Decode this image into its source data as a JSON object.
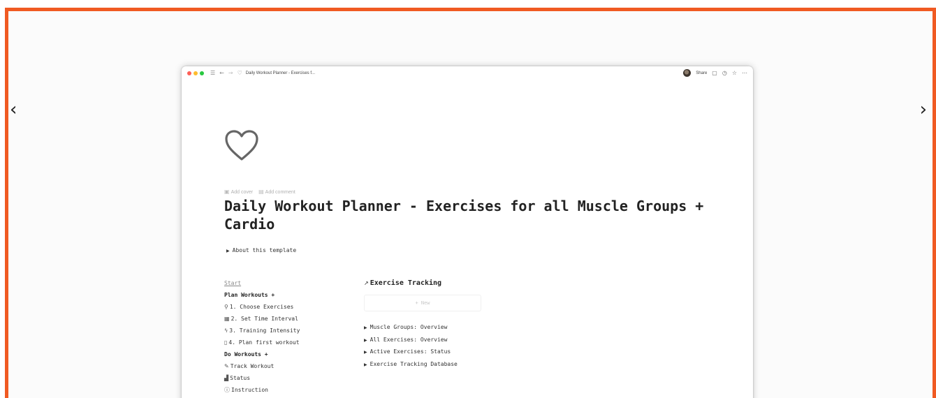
{
  "carousel": {
    "prev_glyph": "‹",
    "next_glyph": "›"
  },
  "browser": {
    "title": "Daily Workout Planner - Exercises f...",
    "share_label": "Share",
    "icons": [
      "sidebar-icon",
      "back-arrow-icon",
      "forward-arrow-icon",
      "heart-icon",
      "comment-icon",
      "history-icon",
      "star-icon",
      "more-icon"
    ]
  },
  "page": {
    "icon": "heart-outline",
    "add_cover": "Add cover",
    "add_comment": "Add comment",
    "title": "Daily Workout Planner - Exercises for all Muscle Groups + Cardio",
    "about_toggle": "About this template"
  },
  "left_nav": {
    "start": "Start",
    "plan_heading": "Plan Workouts +",
    "plan_items": [
      {
        "icon": "magnifier-icon",
        "label": "1. Choose Exercises"
      },
      {
        "icon": "calendar-icon",
        "label": "2. Set Time Interval"
      },
      {
        "icon": "lightning-icon",
        "label": "3. Training Intensity"
      },
      {
        "icon": "document-icon",
        "label": "4. Plan first workout"
      }
    ],
    "do_heading": "Do Workouts +",
    "do_items": [
      {
        "icon": "pencil-icon",
        "label": "Track Workout"
      },
      {
        "icon": "chart-icon",
        "label": "Status"
      },
      {
        "icon": "info-icon",
        "label": "Instruction"
      }
    ]
  },
  "right_section": {
    "linked_db_title": "Exercise Tracking",
    "new_label": "+ New",
    "toggles": [
      "Muscle Groups: Overview",
      "All Exercises: Overview",
      "Active Exercises: Status",
      "Exercise Tracking Database"
    ]
  },
  "colors": {
    "frame": "#f05a22",
    "background": "#fbfbfb"
  }
}
